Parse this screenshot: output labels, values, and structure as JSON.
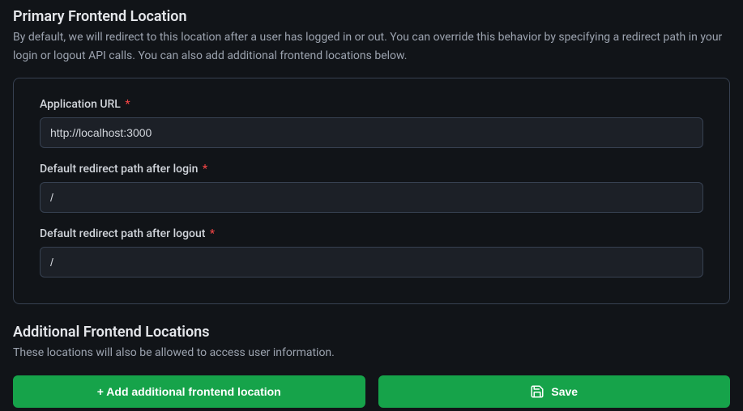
{
  "primary": {
    "title": "Primary Frontend Location",
    "description": "By default, we will redirect to this location after a user has logged in or out. You can override this behavior by specifying a redirect path in your login or logout API calls. You can also add additional frontend locations below.",
    "fields": {
      "app_url": {
        "label": "Application URL",
        "required": "*",
        "value": "http://localhost:3000"
      },
      "login_redirect": {
        "label": "Default redirect path after login",
        "required": "*",
        "value": "/"
      },
      "logout_redirect": {
        "label": "Default redirect path after logout",
        "required": "*",
        "value": "/"
      }
    }
  },
  "additional": {
    "title": "Additional Frontend Locations",
    "description": "These locations will also be allowed to access user information."
  },
  "buttons": {
    "add": "+ Add additional frontend location",
    "save": "Save"
  }
}
